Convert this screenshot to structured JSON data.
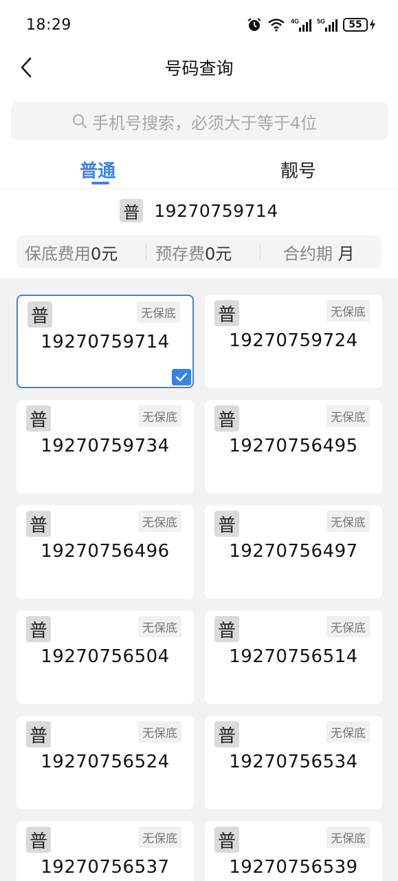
{
  "status_bar": {
    "time": "18:29",
    "net1": "4G",
    "net2": "5G",
    "battery": "55",
    "icons": [
      "alarm-icon",
      "wifi-icon",
      "signal-4g-icon",
      "signal-5g-icon",
      "battery-icon",
      "charging-icon"
    ]
  },
  "header": {
    "title": "号码查询",
    "back_icon": "chevron-left-icon"
  },
  "search": {
    "placeholder": "手机号搜索，必须大于等于4位",
    "icon": "search-icon"
  },
  "tabs": [
    {
      "label": "普通",
      "active": true
    },
    {
      "label": "靓号",
      "active": false
    }
  ],
  "selected": {
    "badge": "普",
    "number": "19270759714"
  },
  "fees": {
    "min_fee_label": "保底费用",
    "min_fee_value": "0元",
    "prestore_label": "预存费",
    "prestore_value": "0元",
    "contract_label": "合约期",
    "contract_value": "月"
  },
  "colors": {
    "accent": "#3b82e6",
    "badge_bg": "#dadada",
    "grid_bg": "#f2f2f2"
  },
  "cards": [
    {
      "badge": "普",
      "tag": "无保底",
      "number": "19270759714",
      "selected": true
    },
    {
      "badge": "普",
      "tag": "无保底",
      "number": "19270759724",
      "selected": false
    },
    {
      "badge": "普",
      "tag": "无保底",
      "number": "19270759734",
      "selected": false
    },
    {
      "badge": "普",
      "tag": "无保底",
      "number": "19270756495",
      "selected": false
    },
    {
      "badge": "普",
      "tag": "无保底",
      "number": "19270756496",
      "selected": false
    },
    {
      "badge": "普",
      "tag": "无保底",
      "number": "19270756497",
      "selected": false
    },
    {
      "badge": "普",
      "tag": "无保底",
      "number": "19270756504",
      "selected": false
    },
    {
      "badge": "普",
      "tag": "无保底",
      "number": "19270756514",
      "selected": false
    },
    {
      "badge": "普",
      "tag": "无保底",
      "number": "19270756524",
      "selected": false
    },
    {
      "badge": "普",
      "tag": "无保底",
      "number": "19270756534",
      "selected": false
    },
    {
      "badge": "普",
      "tag": "无保底",
      "number": "19270756537",
      "selected": false
    },
    {
      "badge": "普",
      "tag": "无保底",
      "number": "19270756539",
      "selected": false
    }
  ]
}
